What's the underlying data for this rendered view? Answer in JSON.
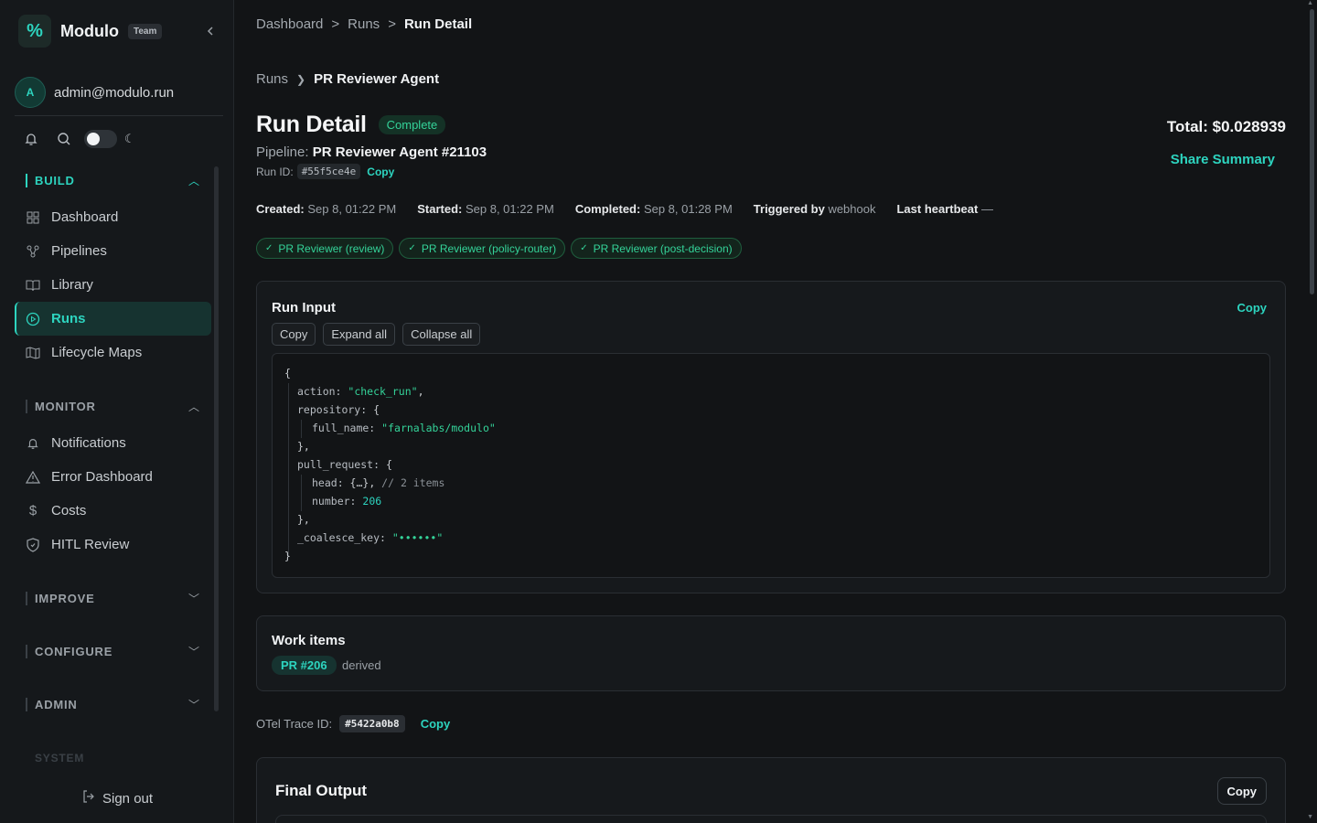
{
  "sidebar": {
    "brand_name": "Modulo",
    "team_badge": "Team",
    "user_initial": "A",
    "user_email": "admin@modulo.run",
    "sections": {
      "build": "BUILD",
      "monitor": "MONITOR",
      "improve": "IMPROVE",
      "configure": "CONFIGURE",
      "admin": "ADMIN",
      "system": "SYSTEM"
    },
    "build_items": [
      "Dashboard",
      "Pipelines",
      "Library",
      "Runs",
      "Lifecycle Maps"
    ],
    "monitor_items": [
      "Notifications",
      "Error Dashboard",
      "Costs",
      "HITL Review"
    ],
    "selected_item": "Runs",
    "sign_out": "Sign out"
  },
  "breadcrumb": [
    "Dashboard",
    "Runs",
    "Run Detail"
  ],
  "sub_breadcrumb": [
    "Runs",
    "PR Reviewer Agent"
  ],
  "run": {
    "title": "Run Detail",
    "status": "Complete",
    "total": "Total: $0.028939",
    "share_label": "Share Summary",
    "pipeline_label": "Pipeline:",
    "pipeline_name": "PR Reviewer Agent #21103",
    "run_id_label": "Run ID:",
    "run_id": "#55f5ce4e",
    "copy_label": "Copy",
    "created_label": "Created:",
    "created": "Sep 8, 01:22 PM",
    "started_label": "Started:",
    "started": "Sep 8, 01:22 PM",
    "completed_label": "Completed:",
    "completed": "Sep 8, 01:28 PM",
    "triggered_label": "Triggered by",
    "triggered": "webhook",
    "heartbeat_label": "Last heartbeat",
    "heartbeat": "—",
    "stages": [
      "PR Reviewer (review)",
      "PR Reviewer (policy-router)",
      "PR Reviewer (post-decision)"
    ]
  },
  "run_input": {
    "title": "Run Input",
    "copy": "Copy",
    "expand": "Expand all",
    "collapse": "Collapse all",
    "json": {
      "action": "\"check_run\"",
      "full_name": "\"farnalabs/modulo\"",
      "head_comment": "// 2 items",
      "number": "206",
      "coalesce_key": "\"••••••\""
    }
  },
  "work_items": {
    "title": "Work items",
    "tag": "PR #206",
    "note": "derived"
  },
  "otel": {
    "label": "OTel Trace ID:",
    "id": "#5422a0b8",
    "copy": "Copy"
  },
  "final_output": {
    "title": "Final Output",
    "copy": "Copy"
  },
  "colors": {
    "accent": "#2dd4bf",
    "success": "#34d399",
    "background": "#121416"
  }
}
